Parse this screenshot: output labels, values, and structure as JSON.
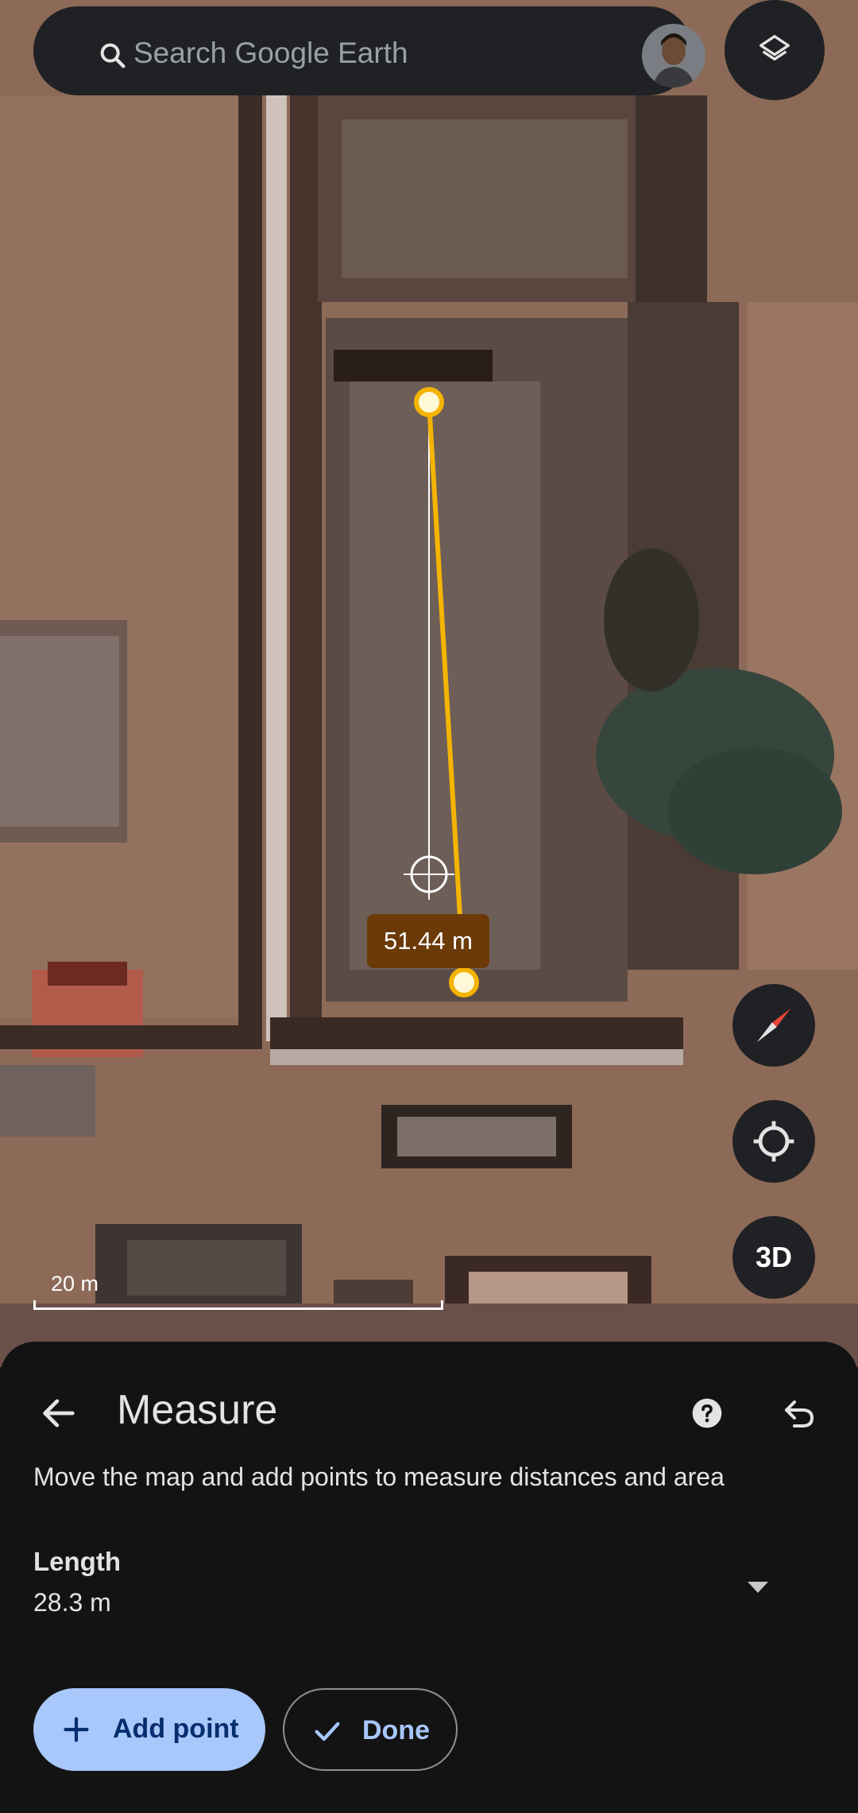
{
  "search": {
    "placeholder": "Search Google Earth"
  },
  "map": {
    "measurement_label": "51.44 m",
    "scale_label": "20 m",
    "controls": {
      "compass": "compass-icon",
      "my_location": "my-location-icon",
      "view_3d_label": "3D"
    }
  },
  "icons": {
    "search": "search-icon",
    "layers": "layers-icon",
    "back": "arrow-back-icon",
    "help": "help-icon",
    "undo": "undo-icon",
    "dropdown": "arrow-drop-down-icon",
    "add": "plus-icon",
    "done": "check-icon"
  },
  "sheet": {
    "title": "Measure",
    "instructions": "Move the map and add points to measure distances and area",
    "measurement": {
      "label": "Length",
      "value": "28.3 m"
    },
    "add_point_label": "Add point",
    "done_label": "Done"
  },
  "colors": {
    "measure_line": "#f4b400",
    "accent": "#a8c7fa",
    "label_bg": "#6b3a08",
    "surface": "#131314"
  }
}
